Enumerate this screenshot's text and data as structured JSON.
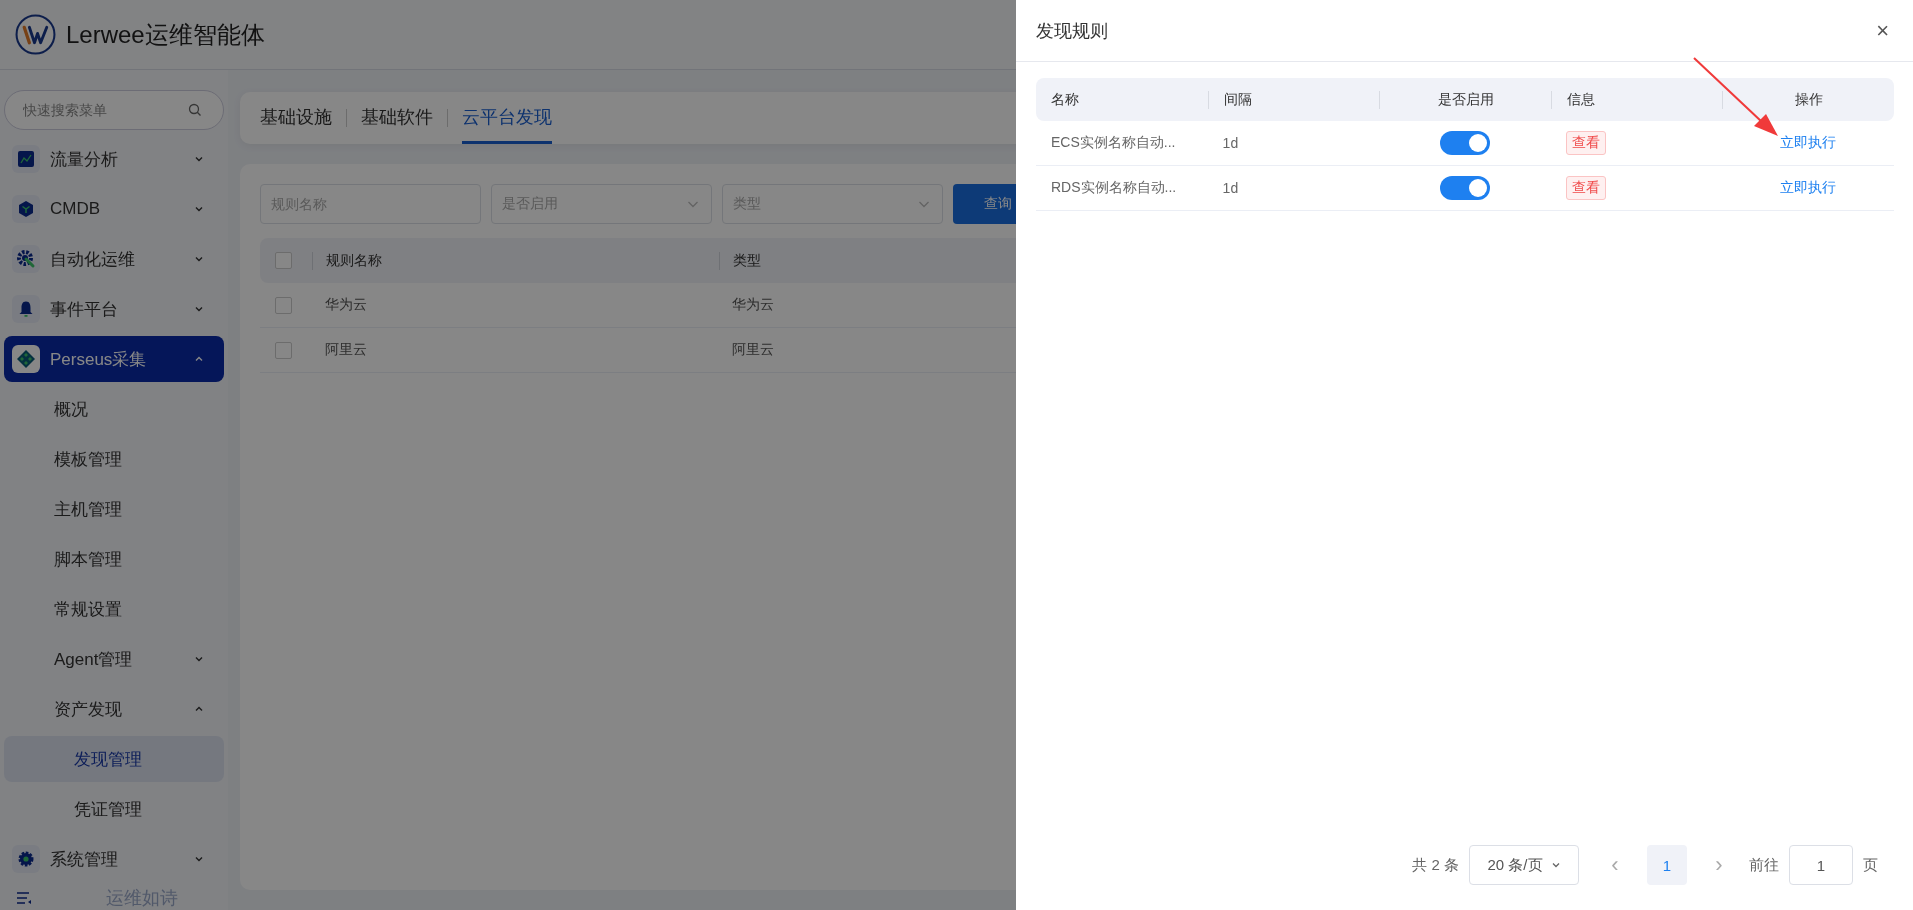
{
  "header": {
    "logo_text": "Lerwee运维智能体"
  },
  "sidebar": {
    "search": {
      "placeholder": "快速搜索菜单"
    },
    "items": [
      {
        "label": "流量分析",
        "expanded": false,
        "selected": false
      },
      {
        "label": "CMDB",
        "expanded": false,
        "selected": false
      },
      {
        "label": "自动化运维",
        "expanded": false,
        "selected": false
      },
      {
        "label": "事件平台",
        "expanded": false,
        "selected": false
      },
      {
        "label": "Perseus采集",
        "expanded": true,
        "selected": true,
        "children": [
          {
            "label": "概况",
            "selected": false
          },
          {
            "label": "模板管理",
            "selected": false
          },
          {
            "label": "主机管理",
            "selected": false
          },
          {
            "label": "脚本管理",
            "selected": false
          },
          {
            "label": "常规设置",
            "selected": false
          },
          {
            "label": "Agent管理",
            "expanded": false,
            "selected": false
          },
          {
            "label": "资产发现",
            "expanded": true,
            "selected": false,
            "children": [
              {
                "label": "发现管理",
                "selected": true
              },
              {
                "label": "凭证管理",
                "selected": false
              }
            ]
          }
        ]
      },
      {
        "label": "系统管理",
        "expanded": false,
        "selected": false
      }
    ],
    "footer_text": "运维如诗"
  },
  "tabs": [
    {
      "label": "基础设施",
      "selected": false
    },
    {
      "label": "基础软件",
      "selected": false
    },
    {
      "label": "云平台发现",
      "selected": true
    }
  ],
  "filters": {
    "name": {
      "placeholder": "规则名称"
    },
    "enabled": {
      "placeholder": "是否启用"
    },
    "type": {
      "placeholder": "类型"
    },
    "query_button": "查询"
  },
  "table": {
    "all_checked": false,
    "columns": [
      "规则名称",
      "类型"
    ],
    "rows": [
      {
        "checked": false,
        "cells": [
          "华为云",
          "华为云"
        ]
      },
      {
        "checked": false,
        "cells": [
          "阿里云",
          "阿里云"
        ]
      }
    ]
  },
  "drawer": {
    "title": "发现规则",
    "close": "×",
    "columns": [
      "名称",
      "间隔",
      "是否启用",
      "信息",
      "操作"
    ],
    "rows": [
      {
        "name": "ECS实例名称自动...",
        "interval": "1d",
        "on": true,
        "info": "查看",
        "action": "立即执行"
      },
      {
        "name": "RDS实例名称自动...",
        "interval": "1d",
        "on": true,
        "info": "查看",
        "action": "立即执行"
      }
    ],
    "pagination": {
      "total": "共 2 条",
      "page_size": "20 条/页",
      "prev": "‹",
      "pages": [
        {
          "label": "1",
          "selected": true
        }
      ],
      "next": "›",
      "goto_label": "前往",
      "goto_value": "1",
      "goto_suffix": "页"
    }
  }
}
